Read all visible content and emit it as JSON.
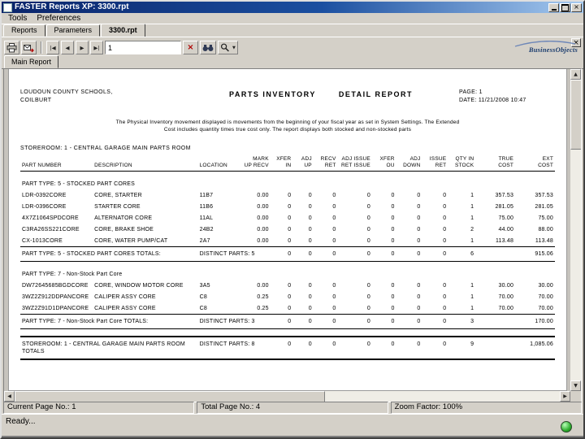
{
  "window": {
    "title": "FASTER Reports XP: 3300.rpt"
  },
  "menu": {
    "tools": "Tools",
    "preferences": "Preferences"
  },
  "tabs": [
    {
      "label": "Reports"
    },
    {
      "label": "Parameters"
    },
    {
      "label": "3300.rpt"
    }
  ],
  "toolbar": {
    "page_value": "1",
    "first_glyph": "|◀",
    "prev_glyph": "◀",
    "next_glyph": "▶",
    "last_glyph": "▶|",
    "stop_glyph": "×",
    "dropdown_glyph": "▼",
    "close_glyph": "×"
  },
  "logo": {
    "text": "BusinessObjects"
  },
  "viewer": {
    "tab_label": "Main Report"
  },
  "report": {
    "company_line1": "LOUDOUN COUNTY SCHOOLS,",
    "company_line2": "COILBURT",
    "title_part1": "PARTS INVENTORY",
    "title_part2": "DETAIL REPORT",
    "page_label": "PAGE: 1",
    "date_label": "DATE: 11/21/2008 10:47",
    "intro_line1": "The Physical Inventory movement displayed is movements from the beginning of your fiscal year as set in System Settings.  The Extended",
    "intro_line2": "Cost includes quantity times true cost only.  The report displays both stocked and non-stocked parts",
    "storeroom": "STOREROOM:  1 - CENTRAL GARAGE MAIN PARTS ROOM",
    "columns": {
      "top": [
        "",
        "",
        "",
        "MARK",
        "XFER",
        "ADJ",
        "RECV",
        "ADJ ISSUE",
        "XFER",
        "ADJ",
        "ISSUE",
        "QTY IN",
        "TRUE",
        "EXT"
      ],
      "bottom": [
        "PART NUMBER",
        "DESCRIPTION",
        "LOCATION",
        "UP RECV",
        "IN",
        "UP",
        "RET",
        "RET ISSUE",
        "OU",
        "DOWN",
        "RET",
        "STOCK",
        "COST",
        "COST"
      ]
    },
    "rows": [
      {
        "type": "group",
        "label": "PART TYPE:  5 - STOCKED PART CORES"
      },
      {
        "type": "part",
        "cells": [
          "LDR-0392CORE",
          "CORE, STARTER",
          "11B7",
          "0.00",
          "0",
          "0",
          "0",
          "0",
          "0",
          "0",
          "0",
          "1",
          "357.53",
          "357.53"
        ]
      },
      {
        "type": "part",
        "cells": [
          "LDR-0396CORE",
          "STARTER CORE",
          "11B6",
          "0.00",
          "0",
          "0",
          "0",
          "0",
          "0",
          "0",
          "0",
          "1",
          "281.05",
          "281.05"
        ]
      },
      {
        "type": "part",
        "cells": [
          "4X7Z1064SPDCORE",
          "ALTERNATOR CORE",
          "11AL",
          "0.00",
          "0",
          "0",
          "0",
          "0",
          "0",
          "0",
          "0",
          "1",
          "75.00",
          "75.00"
        ]
      },
      {
        "type": "part",
        "cells": [
          "C3RA26SS221CORE",
          "CORE, BRAKE SHOE",
          "24B2",
          "0.00",
          "0",
          "0",
          "0",
          "0",
          "0",
          "0",
          "0",
          "2",
          "44.00",
          "88.00"
        ]
      },
      {
        "type": "part",
        "cells": [
          "CX-1013CORE",
          "CORE, WATER PUMP/CAT",
          "2A7",
          "0.00",
          "0",
          "0",
          "0",
          "0",
          "0",
          "0",
          "0",
          "1",
          "113.48",
          "113.48"
        ]
      },
      {
        "type": "totals",
        "label": "PART TYPE:  5 - STOCKED PART CORES TOTALS:",
        "distinct": "DISTINCT PARTS: 5",
        "counts": [
          "0",
          "0",
          "0",
          "0",
          "0",
          "0",
          "0"
        ],
        "qty": "6",
        "true_cost": "",
        "ext_cost": "915.06"
      },
      {
        "type": "group",
        "label": "PART TYPE:  7 - Non-Stock Part Core"
      },
      {
        "type": "part",
        "cells": [
          "DW72645685BGDCORE",
          "CORE, WINDOW MOTOR CORE",
          "3A5",
          "0.00",
          "0",
          "0",
          "0",
          "0",
          "0",
          "0",
          "0",
          "1",
          "30.00",
          "30.00"
        ]
      },
      {
        "type": "part",
        "cells": [
          "3WZ2Z912DDPANCORE",
          "CALIPER ASSY CORE",
          "C8",
          "0.25",
          "0",
          "0",
          "0",
          "0",
          "0",
          "0",
          "0",
          "1",
          "70.00",
          "70.00"
        ]
      },
      {
        "type": "part",
        "cells": [
          "3WZ2Z91D1DPANCORE",
          "CALIPER ASSY CORE",
          "C8",
          "0.25",
          "0",
          "0",
          "0",
          "0",
          "0",
          "0",
          "0",
          "1",
          "70.00",
          "70.00"
        ]
      },
      {
        "type": "totals",
        "label": "PART TYPE:  7 - Non-Stock Part Core TOTALS:",
        "distinct": "DISTINCT PARTS: 3",
        "counts": [
          "0",
          "0",
          "0",
          "0",
          "0",
          "0",
          "0"
        ],
        "qty": "3",
        "true_cost": "",
        "ext_cost": "170.00"
      },
      {
        "type": "storeroom_totals",
        "label": "STOREROOM:  1 - CENTRAL GARAGE MAIN PARTS ROOM TOTALS",
        "distinct": "DISTINCT PARTS: 8",
        "counts": [
          "0",
          "0",
          "0",
          "0",
          "0",
          "0",
          "0"
        ],
        "qty": "9",
        "true_cost": "",
        "ext_cost": "1,085.06"
      }
    ]
  },
  "statusbar": {
    "current_page": "Current Page No.: 1",
    "total_page": "Total Page No.: 4",
    "zoom": "Zoom Factor: 100%"
  },
  "app_status": {
    "ready": "Ready..."
  }
}
